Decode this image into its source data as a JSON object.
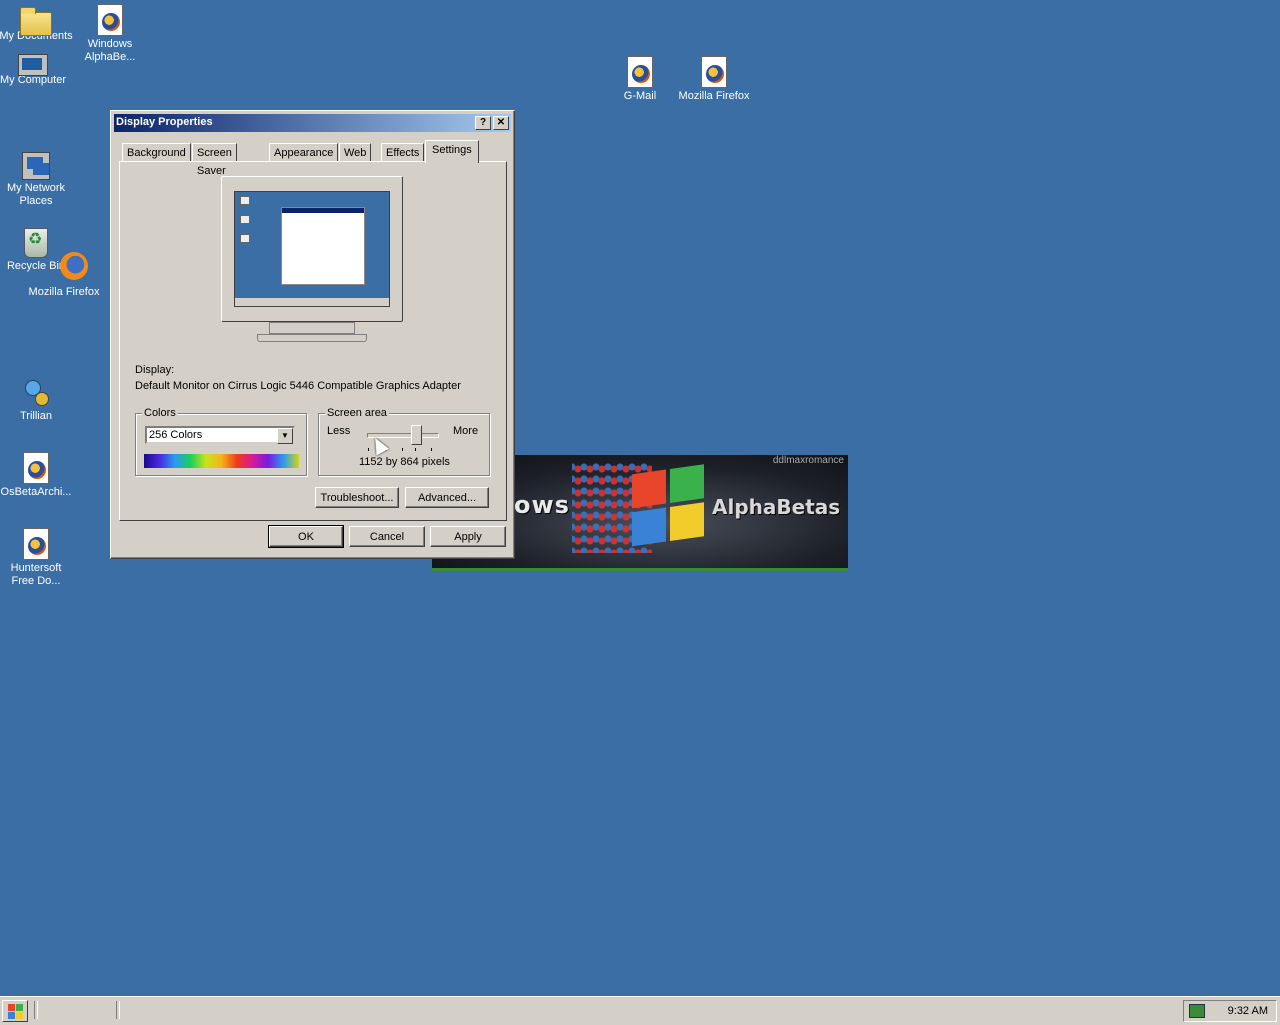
{
  "desktop": {
    "icons": [
      {
        "label": "My Documents"
      },
      {
        "label": "Windows AlphaBe..."
      },
      {
        "label": "My Computer"
      },
      {
        "label": "G-Mail"
      },
      {
        "label": "Mozilla Firefox"
      },
      {
        "label": "My Network Places"
      },
      {
        "label": "Recycle Bin"
      },
      {
        "label": "Mozilla Firefox"
      },
      {
        "label": "Trillian"
      },
      {
        "label": "OsBetaArchi..."
      },
      {
        "label": "Huntersoft Free Do..."
      }
    ]
  },
  "banner": {
    "left_text": "ows",
    "right_text": "AlphaBetas",
    "credit": "ddlmaxromance"
  },
  "dialog": {
    "title": "Display Properties",
    "help_label": "?",
    "close_label": "✕",
    "tabs": [
      {
        "label": "Background"
      },
      {
        "label": "Screen Saver"
      },
      {
        "label": "Appearance"
      },
      {
        "label": "Web"
      },
      {
        "label": "Effects"
      },
      {
        "label": "Settings"
      }
    ],
    "active_tab": "Settings",
    "display_label": "Display:",
    "display_value": "Default Monitor on Cirrus Logic 5446 Compatible Graphics Adapter",
    "colors": {
      "legend": "Colors",
      "selected": "256 Colors"
    },
    "screen_area": {
      "legend": "Screen area",
      "less_label": "Less",
      "more_label": "More",
      "resolution_text": "1152 by 864 pixels",
      "slider_position_fraction": 0.75
    },
    "buttons": {
      "troubleshoot": "Troubleshoot...",
      "advanced": "Advanced...",
      "ok": "OK",
      "cancel": "Cancel",
      "apply": "Apply"
    }
  },
  "taskbar": {
    "clock": "9:32 AM"
  },
  "colors": {
    "desktop": "#3a6ea5",
    "title_active": "#0a246a",
    "face": "#d4d0c8"
  }
}
